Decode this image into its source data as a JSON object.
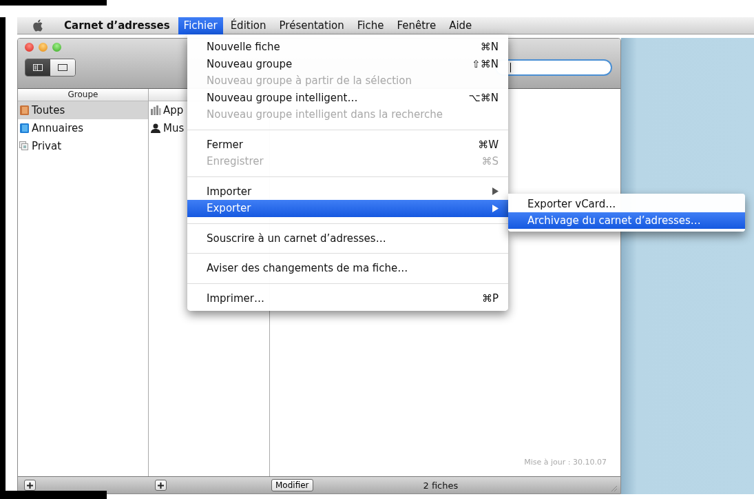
{
  "menu_bar": {
    "app_name": "Carnet d’adresses",
    "menus": [
      {
        "label": "Fichier",
        "selected": true
      },
      {
        "label": "Édition",
        "selected": false
      },
      {
        "label": "Présentation",
        "selected": false
      },
      {
        "label": "Fiche",
        "selected": false
      },
      {
        "label": "Fenêtre",
        "selected": false
      },
      {
        "label": "Aide",
        "selected": false
      }
    ]
  },
  "file_menu": {
    "items": [
      {
        "kind": "item",
        "label": "Nouvelle fiche",
        "shortcut": "⌘N",
        "disabled": false,
        "selected": false,
        "submenu": false
      },
      {
        "kind": "item",
        "label": "Nouveau groupe",
        "shortcut": "⇧⌘N",
        "disabled": false,
        "selected": false,
        "submenu": false
      },
      {
        "kind": "item",
        "label": "Nouveau groupe à partir de la sélection",
        "disabled": true,
        "selected": false,
        "submenu": false
      },
      {
        "kind": "item",
        "label": "Nouveau groupe intelligent…",
        "shortcut": "⌥⌘N",
        "disabled": false,
        "selected": false,
        "submenu": false
      },
      {
        "kind": "item",
        "label": "Nouveau groupe intelligent dans la recherche",
        "disabled": true,
        "selected": false,
        "submenu": false
      },
      {
        "kind": "separator"
      },
      {
        "kind": "item",
        "label": "Fermer",
        "shortcut": "⌘W",
        "disabled": false,
        "selected": false,
        "submenu": false
      },
      {
        "kind": "item",
        "label": "Enregistrer",
        "shortcut": "⌘S",
        "disabled": true,
        "selected": false,
        "submenu": false
      },
      {
        "kind": "separator"
      },
      {
        "kind": "item",
        "label": "Importer",
        "disabled": false,
        "selected": false,
        "submenu": true
      },
      {
        "kind": "item",
        "label": "Exporter",
        "disabled": false,
        "selected": true,
        "submenu": true
      },
      {
        "kind": "separator"
      },
      {
        "kind": "item",
        "label": "Souscrire à un carnet d’adresses…",
        "disabled": false,
        "selected": false,
        "submenu": false
      },
      {
        "kind": "separator"
      },
      {
        "kind": "item",
        "label": "Aviser des changements de ma fiche…",
        "disabled": false,
        "selected": false,
        "submenu": false
      },
      {
        "kind": "separator"
      },
      {
        "kind": "item",
        "label": "Imprimer…",
        "shortcut": "⌘P",
        "disabled": false,
        "selected": false,
        "submenu": false
      }
    ]
  },
  "export_submenu": {
    "items": [
      {
        "label": "Exporter vCard…",
        "selected": false
      },
      {
        "label": "Archivage du carnet d’adresses…",
        "selected": true
      }
    ]
  },
  "window": {
    "view_modes": [
      {
        "kind": "list",
        "selected": true
      },
      {
        "kind": "card",
        "selected": false
      }
    ],
    "groups": {
      "header": "Groupe",
      "items": [
        {
          "kind": "all",
          "label": "Toutes",
          "selected": true
        },
        {
          "kind": "directory",
          "label": "Annuaires",
          "selected": false
        },
        {
          "kind": "group",
          "label": "Privat",
          "selected": false
        }
      ]
    },
    "contacts": [
      {
        "kind": "company",
        "name": "App"
      },
      {
        "kind": "person",
        "name": "Mus"
      }
    ],
    "updated": "Mise à jour : 30.10.07",
    "edit_button": "Modifier",
    "count": "2 fiches"
  }
}
